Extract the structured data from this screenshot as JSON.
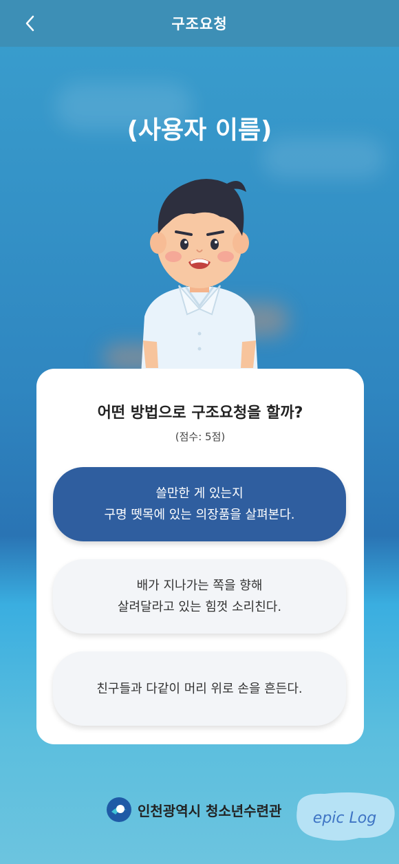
{
  "header": {
    "title": "구조요청",
    "back_icon": "chevron-left-icon"
  },
  "profile": {
    "username": "(사용자 이름)"
  },
  "quiz": {
    "question": "어떤 방법으로 구조요청을 할까?",
    "score": "(점수: 5점)",
    "options": [
      {
        "line1": "쓸만한 게 있는지",
        "line2": "구명 뗏목에 있는 의장품을 살펴본다.",
        "selected": true
      },
      {
        "line1": "배가 지나가는 쪽을 향해",
        "line2": "살려달라고 있는 힘껏 소리친다.",
        "selected": false
      },
      {
        "line1": "친구들과 다같이 머리 위로 손을 흔든다.",
        "line2": "",
        "selected": false
      }
    ]
  },
  "footer": {
    "org_name": "인천광역시 청소년수련관",
    "watermark_text": "epic Log"
  },
  "colors": {
    "header": "#3d8fb6",
    "selected_option": "#2f5e9f",
    "option_bg": "#f3f5f8"
  }
}
